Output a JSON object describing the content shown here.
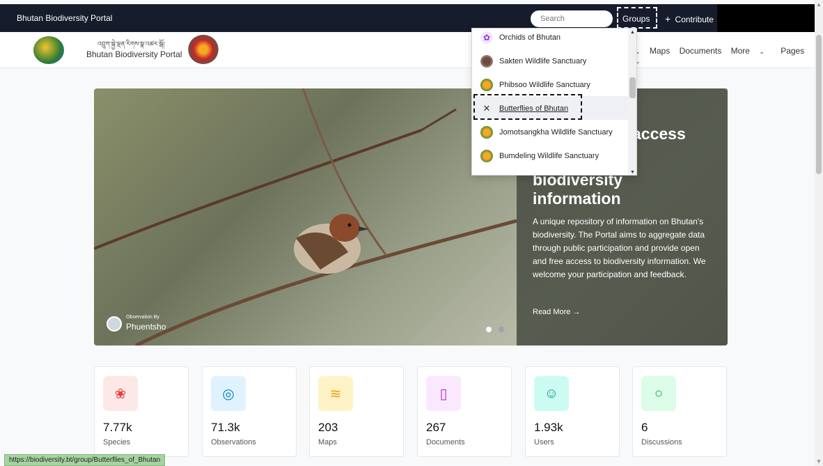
{
  "topbar": {
    "brand": "Bhutan Biodiversity Portal",
    "search_placeholder": "Search",
    "groups_label": "Groups",
    "contribute_label": "Contribute"
  },
  "header": {
    "dzongkha_title": "འབྲུག་སྐྱེ་ལྡན་རིགས་སྣ་འཚར་སྒོ།",
    "title": "Bhutan Biodiversity Portal",
    "nav": {
      "maps": "Maps",
      "documents": "Documents",
      "more": "More",
      "pages": "Pages"
    }
  },
  "dropdown": {
    "items": [
      {
        "label": "Orchids of Bhutan",
        "icon": "orchid-icon"
      },
      {
        "label": "Sakten Wildlife Sanctuary",
        "icon": "sakten-emblem-icon"
      },
      {
        "label": "Phibsoo Wildlife Sanctuary",
        "icon": "phibsoo-emblem-icon"
      },
      {
        "label": "Butterflies of Bhutan",
        "icon": "butterfly-icon"
      },
      {
        "label": "Jomotsangkha Wildlife Sanctuary",
        "icon": "jomotsangkha-emblem-icon"
      },
      {
        "label": "Bumdeling Wildlife Sanctuary",
        "icon": "bumdeling-emblem-icon"
      }
    ]
  },
  "hero": {
    "heading_line1": "access",
    "heading_line2": "biodiversity",
    "heading_line3": "information",
    "description": "A unique repository of information on Bhutan's biodiversity. The Portal aims to aggregate data through public participation and provide open and free access to biodiversity information. We welcome your participation and feedback.",
    "read_more": "Read More",
    "observation_by": "Observation By",
    "observer": "Phuentsho"
  },
  "stats": [
    {
      "value": "7.77k",
      "label": "Species",
      "icon": "paw-icon",
      "bg": "#fde8e8",
      "fg": "#e53e3e"
    },
    {
      "value": "71.3k",
      "label": "Observations",
      "icon": "eye-icon",
      "bg": "#e0f2fe",
      "fg": "#0284c7"
    },
    {
      "value": "203",
      "label": "Maps",
      "icon": "layers-icon",
      "bg": "#fef3c7",
      "fg": "#f59e0b"
    },
    {
      "value": "267",
      "label": "Documents",
      "icon": "book-icon",
      "bg": "#fae8ff",
      "fg": "#c026d3"
    },
    {
      "value": "1.93k",
      "label": "Users",
      "icon": "users-icon",
      "bg": "#ccfbf1",
      "fg": "#0d9488"
    },
    {
      "value": "6",
      "label": "Discussions",
      "icon": "chat-icon",
      "bg": "#dcfce7",
      "fg": "#16a34a"
    }
  ],
  "status_url": "https://biodiversity.bt/group/Butterflies_of_Bhutan"
}
